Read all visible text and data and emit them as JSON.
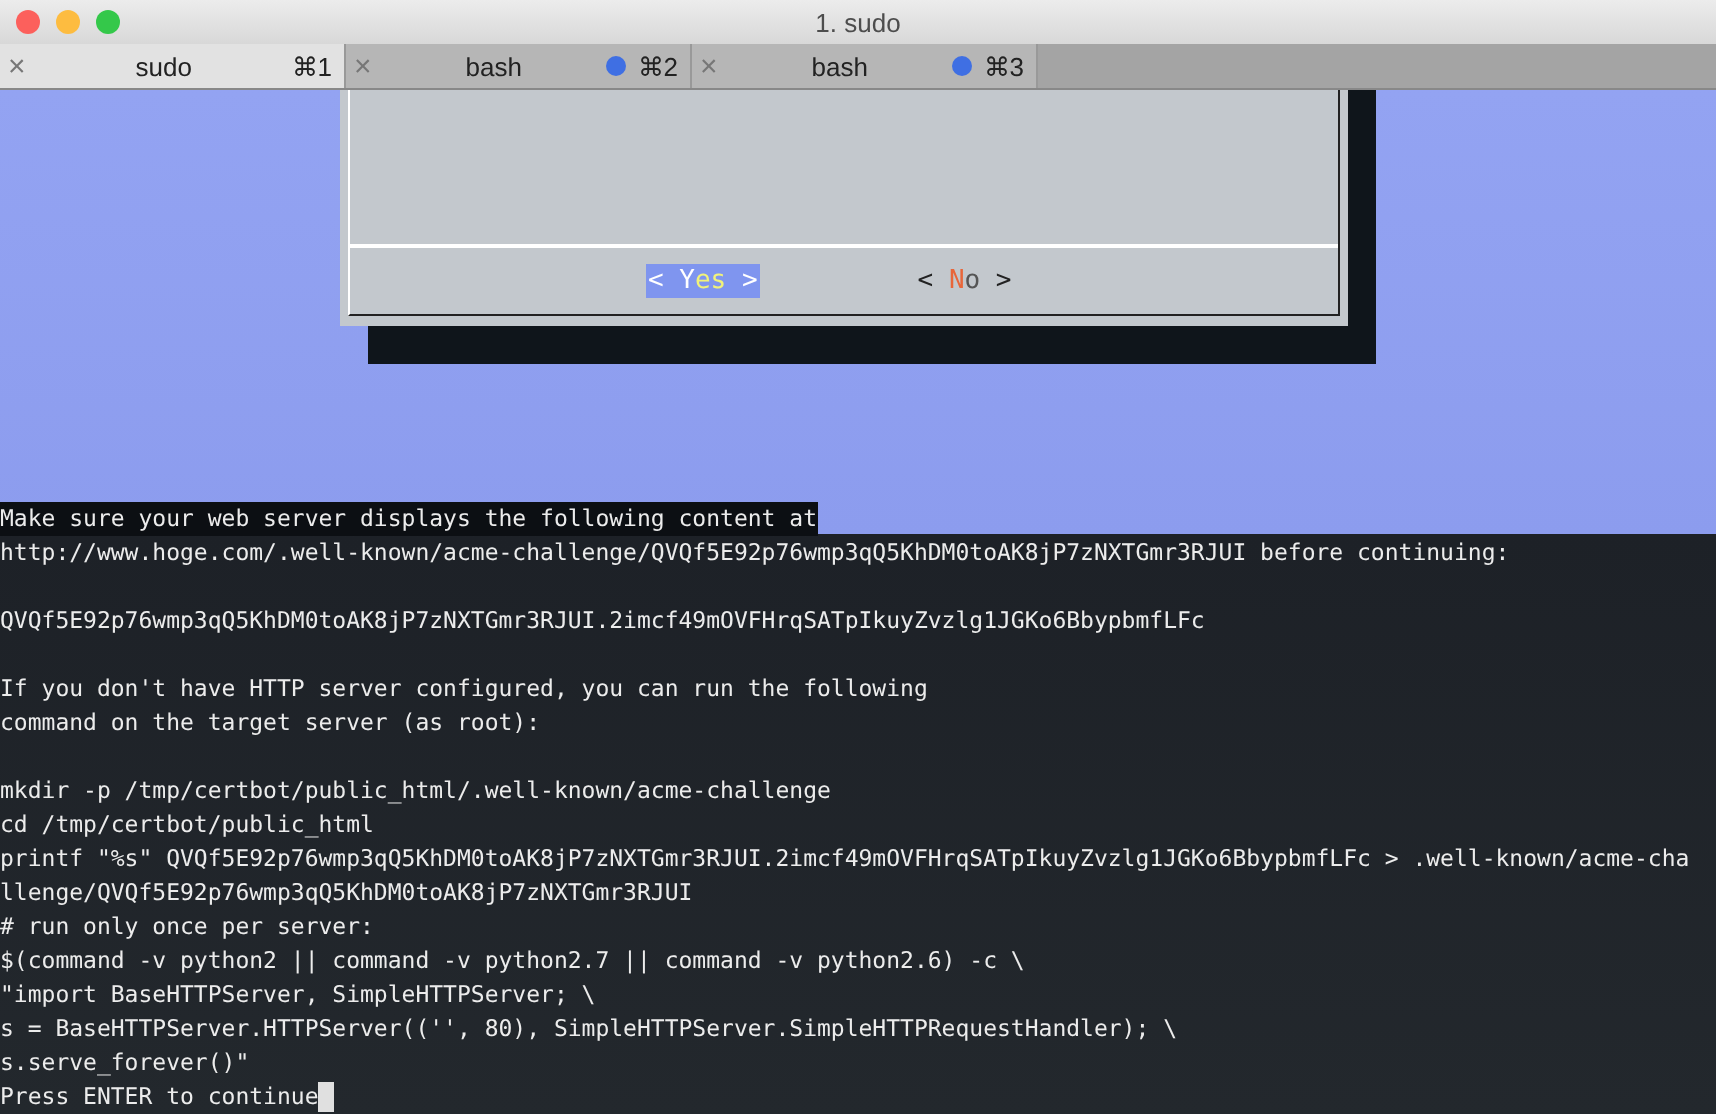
{
  "window": {
    "title": "1. sudo"
  },
  "tabs": [
    {
      "title": "sudo",
      "shortcut": "⌘1",
      "close": "×",
      "selected": true,
      "activity": false
    },
    {
      "title": "bash",
      "shortcut": "⌘2",
      "close": "×",
      "selected": false,
      "activity": true
    },
    {
      "title": "bash",
      "shortcut": "⌘3",
      "close": "×",
      "selected": false,
      "activity": true
    }
  ],
  "dialog": {
    "buttons": [
      {
        "open": "<",
        "hotkey": "Y",
        "rest": "es",
        "close": ">",
        "selected": true
      },
      {
        "open": "<",
        "hotkey": "N",
        "rest": "o",
        "close": ">",
        "selected": false
      }
    ]
  },
  "terminal": {
    "blocks": [
      {
        "lines": [
          {
            "text": "Make sure your web server displays the following content at",
            "highlighted": true
          },
          {
            "text": "http://www.hoge.com/.well-known/acme-challenge/QVQf5E92p76wmp3qQ5KhDM0toAK8jP7zNXTGmr3RJUI before continuing:",
            "highlighted": false
          }
        ]
      },
      {
        "lines": [
          {
            "text": "QVQf5E92p76wmp3qQ5KhDM0toAK8jP7zNXTGmr3RJUI.2imcf49mOVFHrqSATpIkuyZvzlg1JGKo6BbypbmfLFc",
            "highlighted": false
          }
        ]
      },
      {
        "lines": [
          {
            "text": "If you don't have HTTP server configured, you can run the following",
            "highlighted": false
          },
          {
            "text": "command on the target server (as root):",
            "highlighted": false
          }
        ]
      },
      {
        "lines": [
          {
            "text": "mkdir -p /tmp/certbot/public_html/.well-known/acme-challenge",
            "highlighted": false
          },
          {
            "text": "cd /tmp/certbot/public_html",
            "highlighted": false
          },
          {
            "text": "printf \"%s\" QVQf5E92p76wmp3qQ5KhDM0toAK8jP7zNXTGmr3RJUI.2imcf49mOVFHrqSATpIkuyZvzlg1JGKo6BbypbmfLFc > .well-known/acme-cha",
            "highlighted": false
          },
          {
            "text": "llenge/QVQf5E92p76wmp3qQ5KhDM0toAK8jP7zNXTGmr3RJUI",
            "highlighted": false
          },
          {
            "text": "# run only once per server:",
            "highlighted": false
          },
          {
            "text": "$(command -v python2 || command -v python2.7 || command -v python2.6) -c \\",
            "highlighted": false
          },
          {
            "text": "\"import BaseHTTPServer, SimpleHTTPServer; \\",
            "highlighted": false
          },
          {
            "text": "s = BaseHTTPServer.HTTPServer(('', 80), SimpleHTTPServer.SimpleHTTPRequestHandler); \\",
            "highlighted": false
          },
          {
            "text": "s.serve_forever()\"",
            "highlighted": false
          },
          {
            "text": "Press ENTER to continue",
            "highlighted": false
          }
        ]
      }
    ],
    "cursor": true
  }
}
